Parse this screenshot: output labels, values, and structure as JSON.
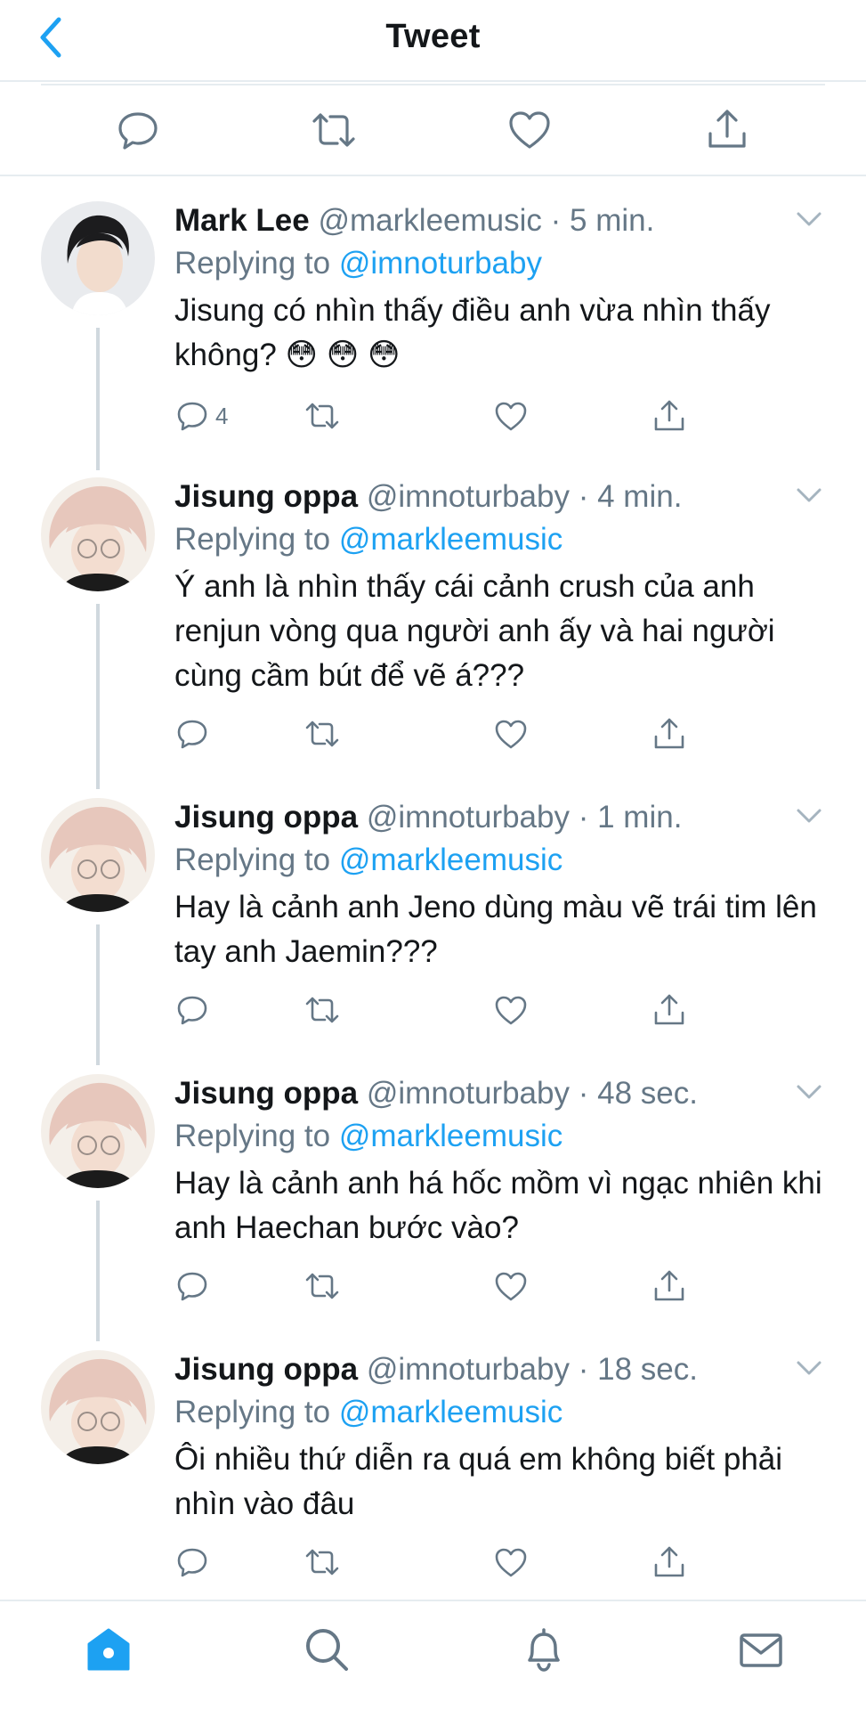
{
  "header": {
    "title": "Tweet"
  },
  "colors": {
    "accent": "#1da1f2",
    "muted": "#657786",
    "divider": "#e6ecf0",
    "thread": "#d0d8de"
  },
  "replies": [
    {
      "name": "Mark Lee",
      "handle": "@markleemusic",
      "time": "· 5 min.",
      "replying_label": "Replying to",
      "replying_to": "@imnoturbaby",
      "text": "Jisung có nhìn thấy điều anh vừa nhìn thấy không? 😳 😳 😳",
      "reply_count": "4"
    },
    {
      "name": "Jisung oppa",
      "handle": "@imnoturbaby",
      "time": "· 4 min.",
      "replying_label": "Replying to",
      "replying_to": "@markleemusic",
      "text": "Ý anh là nhìn thấy cái cảnh crush của anh renjun vòng qua người anh ấy và hai người cùng cầm bút để vẽ á???",
      "reply_count": ""
    },
    {
      "name": "Jisung oppa",
      "handle": "@imnoturbaby",
      "time": "· 1 min.",
      "replying_label": "Replying to",
      "replying_to": "@markleemusic",
      "text": "Hay là cảnh anh Jeno dùng màu vẽ trái tim lên tay anh Jaemin???",
      "reply_count": ""
    },
    {
      "name": "Jisung oppa",
      "handle": "@imnoturbaby",
      "time": "· 48 sec.",
      "replying_label": "Replying to",
      "replying_to": "@markleemusic",
      "text": "Hay là cảnh anh há hốc mồm vì ngạc nhiên khi anh Haechan bước vào?",
      "reply_count": ""
    },
    {
      "name": "Jisung oppa",
      "handle": "@imnoturbaby",
      "time": "· 18 sec.",
      "replying_label": "Replying to",
      "replying_to": "@markleemusic",
      "text": "Ôi nhiều thứ diễn ra quá em không biết phải nhìn vào đâu",
      "reply_count": ""
    }
  ],
  "icons": {
    "back": "chevron-left-icon",
    "reply": "comment-icon",
    "retweet": "retweet-icon",
    "like": "heart-icon",
    "share": "share-icon",
    "home": "home-icon",
    "search": "search-icon",
    "notifications": "bell-icon",
    "messages": "mail-icon"
  }
}
